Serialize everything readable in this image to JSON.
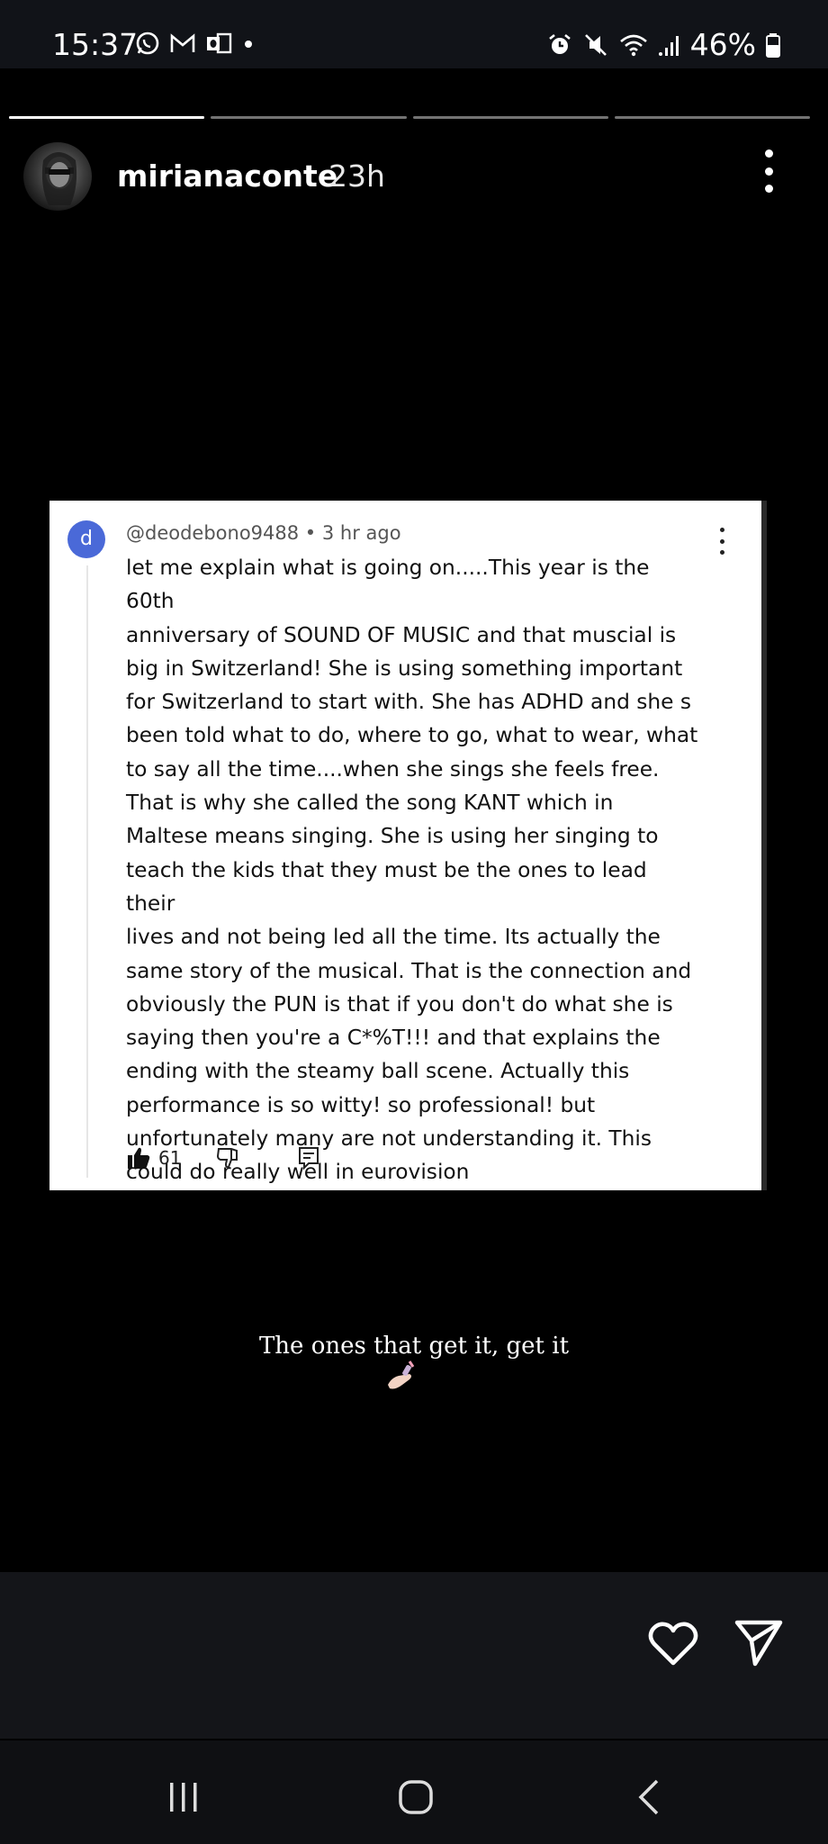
{
  "status_bar": {
    "time": "15:37",
    "battery": "46%",
    "left_icons": [
      "whatsapp-icon",
      "gmail-icon",
      "outlook-icon",
      "dot-icon"
    ],
    "right_icons": [
      "alarm-icon",
      "mute-icon",
      "wifi-icon",
      "signal-icon",
      "battery-icon"
    ]
  },
  "story": {
    "segment_progress": [
      1.0,
      0.0,
      0.0,
      0.0
    ],
    "username": "mirianaconte",
    "time_ago": "23h",
    "caption": "The ones that get it, get it",
    "sticker": "nail-polish-emoji"
  },
  "comment": {
    "avatar_letter": "d",
    "author_line": "@deodebono9488 • 3 hr ago",
    "body": "let me  explain what is going on.....This year is the 60th\nanniversary of SOUND OF MUSIC and that muscial is\nbig in Switzerland! She is using something important\nfor Switzerland to start with. She has ADHD and she s\nbeen told what to do, where to go, what to wear, what\nto say all the time....when she sings she feels free.\nThat is why she called the song KANT which in\nMaltese means singing. She is using her singing to\nteach the kids that they must be the ones to lead their\nlives and not being led all the time. Its actually the\nsame story of the musical. That is the connection and\nobviously the PUN is that if you don't do what she is\nsaying then you're a C*%T!!! and that explains the\nending with the steamy ball scene.  Actually this\nperformance is so witty! so professional! but\nunfortunately many are not understanding it. This\ncould do really well in eurovision",
    "like_count": "61"
  },
  "colors": {
    "background": "#000000",
    "comment_avatar": "#4a69d8",
    "action_area": "#141519"
  }
}
